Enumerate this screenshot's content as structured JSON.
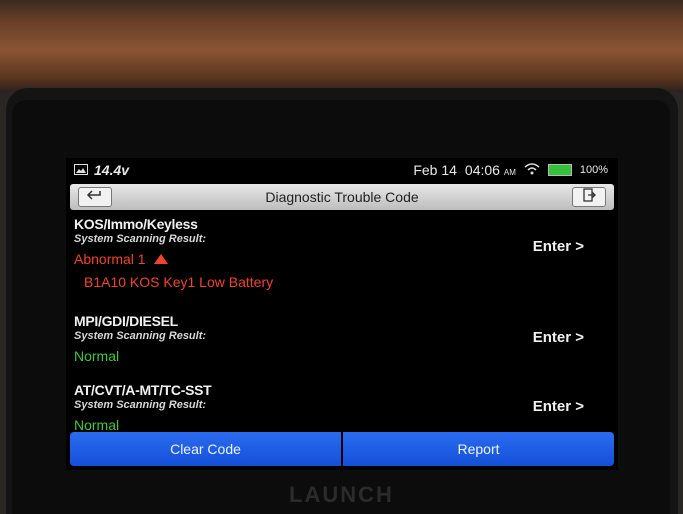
{
  "status_bar": {
    "voltage": "14.4v",
    "date": "Feb 14",
    "time": "04:06",
    "time_suffix": "AM",
    "battery": "100%"
  },
  "header": {
    "title": "Diagnostic Trouble Code"
  },
  "systems": [
    {
      "name": "KOS/Immo/Keyless",
      "subtitle": "System Scanning Result:",
      "status": "Abnormal 1",
      "action": "Enter >",
      "dtc": "B1A10 KOS Key1 Low Battery"
    },
    {
      "name": "MPI/GDI/DIESEL",
      "subtitle": "System Scanning Result:",
      "status": "Normal",
      "action": "Enter >"
    },
    {
      "name": "AT/CVT/A-MT/TC-SST",
      "subtitle": "System Scanning Result:",
      "status": "Normal",
      "action": "Enter >"
    }
  ],
  "footer": {
    "clear_label": "Clear Code",
    "report_label": "Report"
  },
  "device": {
    "brand": "LAUNCH"
  },
  "colors": {
    "normal": "#43c640",
    "abnormal": "#f0432e",
    "button_blue": "#1f5fe6"
  },
  "icons": [
    "image-icon",
    "wifi-icon",
    "battery-icon",
    "back-arrow-icon",
    "exit-icon",
    "triangle-up-icon"
  ]
}
